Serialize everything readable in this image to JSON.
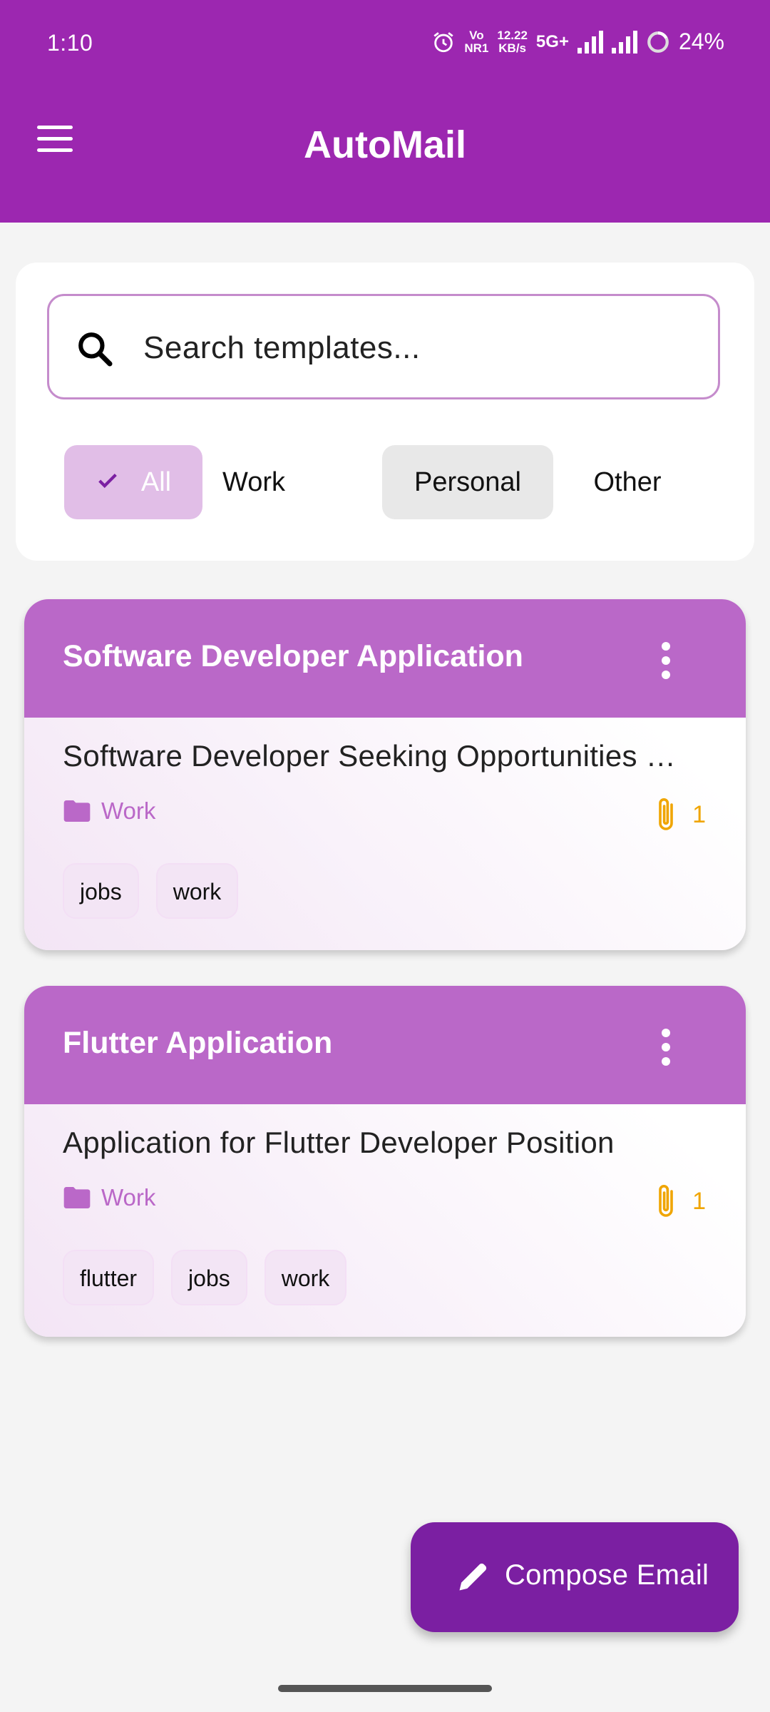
{
  "status_bar": {
    "time": "1:10",
    "volte": "Vo\nNR1",
    "speed": "12.22\nKB/s",
    "network": "5G+",
    "battery": "24%"
  },
  "app_bar": {
    "title": "AutoMail",
    "menu_icon": "hamburger-menu-icon"
  },
  "search": {
    "placeholder": "Search templates...",
    "icon": "search-icon"
  },
  "filters": [
    {
      "label": "All",
      "selected": true
    },
    {
      "label": "Work",
      "selected": false
    },
    {
      "label": "Personal",
      "selected": false
    },
    {
      "label": "Other",
      "selected": false
    }
  ],
  "templates": [
    {
      "title": "Software Developer Application",
      "subject": "Software Developer Seeking Opportunities …",
      "category": "Work",
      "attachments": "1",
      "tags": [
        "jobs",
        "work"
      ]
    },
    {
      "title": "Flutter Application",
      "subject": "Application for Flutter Developer Position",
      "category": "Work",
      "attachments": "1",
      "tags": [
        "flutter",
        "jobs",
        "work"
      ]
    }
  ],
  "fab": {
    "label": "Compose Email",
    "icon": "pencil-icon"
  },
  "colors": {
    "primary": "#9c27b0",
    "card_header": "#ba68c8",
    "fab": "#7b1fa2",
    "attachment": "#f0a500"
  }
}
